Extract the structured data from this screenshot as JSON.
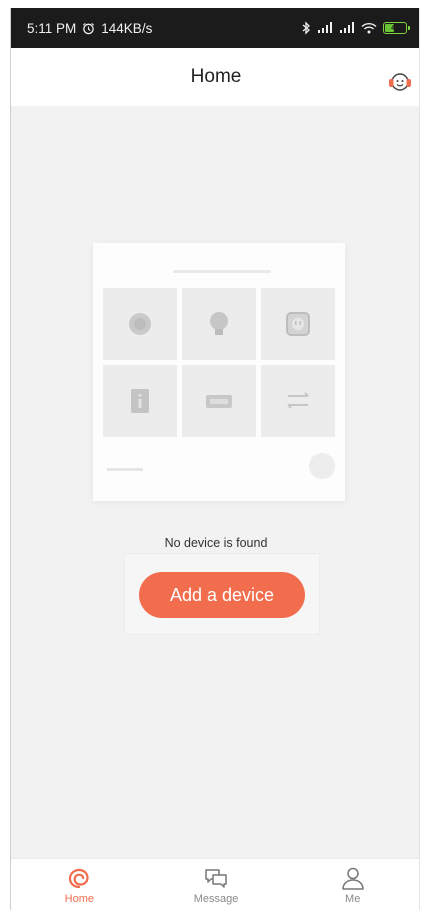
{
  "status_bar": {
    "time": "5:11 PM",
    "alarm_icon": "alarm-clock-icon",
    "net_speed": "144KB/s",
    "bluetooth_icon": "bluetooth-icon",
    "signal_icon": "cellular-signal-icon",
    "wifi_icon": "wifi-icon",
    "battery_level": "48"
  },
  "header": {
    "title": "Home",
    "support_icon": "customer-service-headset-icon"
  },
  "empty_state": {
    "illustration_icons": [
      "smart-bulb-icon",
      "light-bulb-icon",
      "smart-plug-icon",
      "switch-icon",
      "ir-remote-icon",
      "curtain-icon"
    ],
    "message": "No device is found",
    "add_button_label": "Add a device"
  },
  "tabs": [
    {
      "label": "Home",
      "icon": "home-swirl-icon",
      "active": true
    },
    {
      "label": "Message",
      "icon": "chat-bubbles-icon",
      "active": false
    },
    {
      "label": "Me",
      "icon": "person-icon",
      "active": false
    }
  ],
  "colors": {
    "accent": "#f26d4d",
    "status_bar": "#1b1b1b",
    "background": "#f2f2f2"
  }
}
